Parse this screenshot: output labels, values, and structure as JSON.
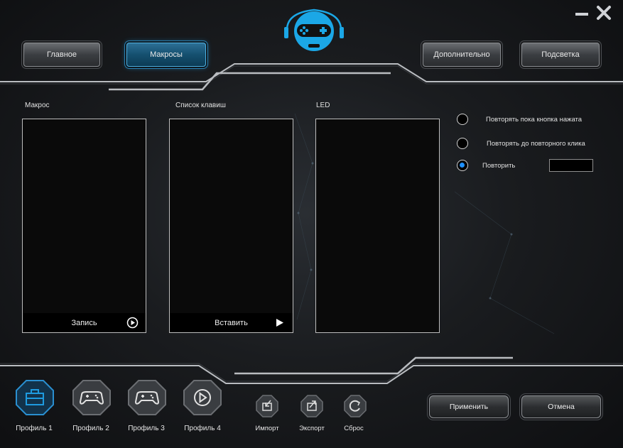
{
  "window": {
    "minimize_icon": "minimize-icon",
    "close_icon": "close-icon",
    "logo_icon": "gamepad-robot-logo-icon",
    "accent": "#1e90ff"
  },
  "nav": {
    "main": "Главное",
    "macros": "Макросы",
    "advanced": "Дополнительно",
    "lighting": "Подсветка",
    "active": "macros"
  },
  "columns": {
    "macro": {
      "label": "Макрос",
      "footer": "Запись",
      "footer_icon": "play-circle-icon"
    },
    "keys": {
      "label": "Список клавиш",
      "footer": "Вставить",
      "footer_icon": "play-triangle-icon"
    },
    "led": {
      "label": "LED"
    }
  },
  "repeat": {
    "options": [
      {
        "label": "Повторять пока кнопка нажата",
        "checked": false
      },
      {
        "label": "Повторять до повторного клика",
        "checked": false
      },
      {
        "label": "Повторить",
        "checked": true
      }
    ],
    "count_value": ""
  },
  "profiles": [
    {
      "label": "Профиль 1",
      "icon": "toolbox-icon",
      "active": true
    },
    {
      "label": "Профиль 2",
      "icon": "gamepad-icon",
      "active": false
    },
    {
      "label": "Профиль 3",
      "icon": "gamepad-icon",
      "active": false
    },
    {
      "label": "Профиль 4",
      "icon": "play-icon",
      "active": false
    }
  ],
  "tools": {
    "import": {
      "label": "Импорт",
      "icon": "import-icon"
    },
    "export": {
      "label": "Экспорт",
      "icon": "export-icon"
    },
    "reset": {
      "label": "Сброс",
      "icon": "reset-icon"
    }
  },
  "actions": {
    "apply": "Применить",
    "cancel": "Отмена"
  }
}
